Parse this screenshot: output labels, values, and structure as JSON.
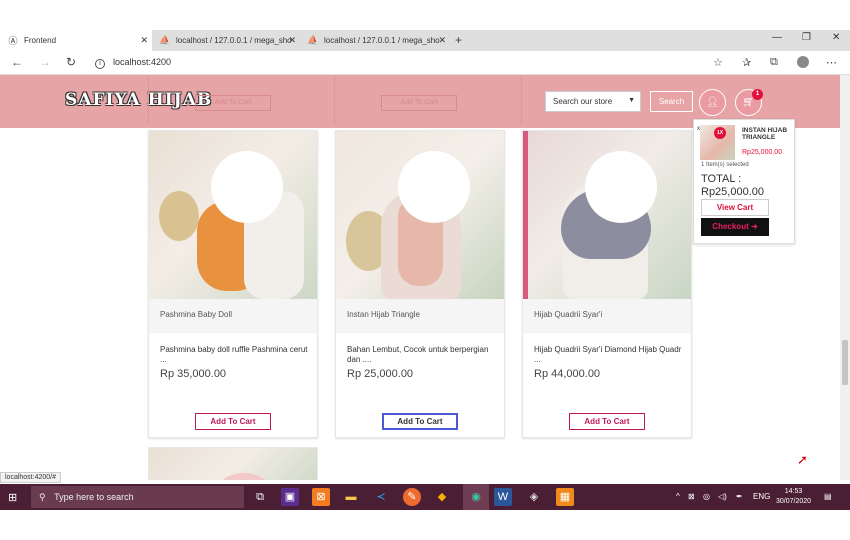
{
  "browser": {
    "tabs": [
      {
        "title": "Frontend",
        "active": true
      },
      {
        "title": "localhost / 127.0.0.1 / mega_sho",
        "active": false
      },
      {
        "title": "localhost / 127.0.0.1 / mega_sho",
        "active": false
      }
    ],
    "url": "localhost:4200",
    "status_url": "localhost:4200/#"
  },
  "header": {
    "logo": "SAFIYA HIJAB",
    "ghost_add_to_cart": "Add To Cart",
    "search_select": "Search our store",
    "search_button": "Search",
    "cart_count": "1"
  },
  "products": [
    {
      "name": "Pashmina Baby Doll",
      "description": "Pashmina baby doll ruffle Pashmina cerut ...",
      "price": "Rp 35,000.00",
      "button": "Add To Cart",
      "color": "#e8923f"
    },
    {
      "name": "Instan Hijab Triangle",
      "description": "Bahan Lembut, Cocok untuk berpergian dan ....",
      "price": "Rp 25,000.00",
      "button": "Add To Cart",
      "color": "#e6b7aa"
    },
    {
      "name": "Hijab Quadrii Syar'i",
      "description": "Hijab Quadrii Syar'i Diamond Hijab Quadr ...",
      "price": "Rp 44,000.00",
      "button": "Add To Cart",
      "color": "#8c8ea0"
    }
  ],
  "mini_cart": {
    "remove": "x",
    "qty": "1X",
    "item_name": "INSTAN HIJAB TRIANGLE",
    "item_price": "Rp25,000.00",
    "selected": "1 Item(s) selected",
    "total_label": "TOTAL :",
    "total_value": "Rp25,000.00",
    "view_cart": "View Cart",
    "checkout": "Checkout"
  },
  "taskbar": {
    "search_placeholder": "Type here to search",
    "language": "ENG",
    "time": "14:53",
    "date": "30/07/2020"
  },
  "colors": {
    "header": "#e6a4a6",
    "accent": "#c2185b",
    "badge": "#e0103a",
    "taskbar": "#4b1f33"
  }
}
